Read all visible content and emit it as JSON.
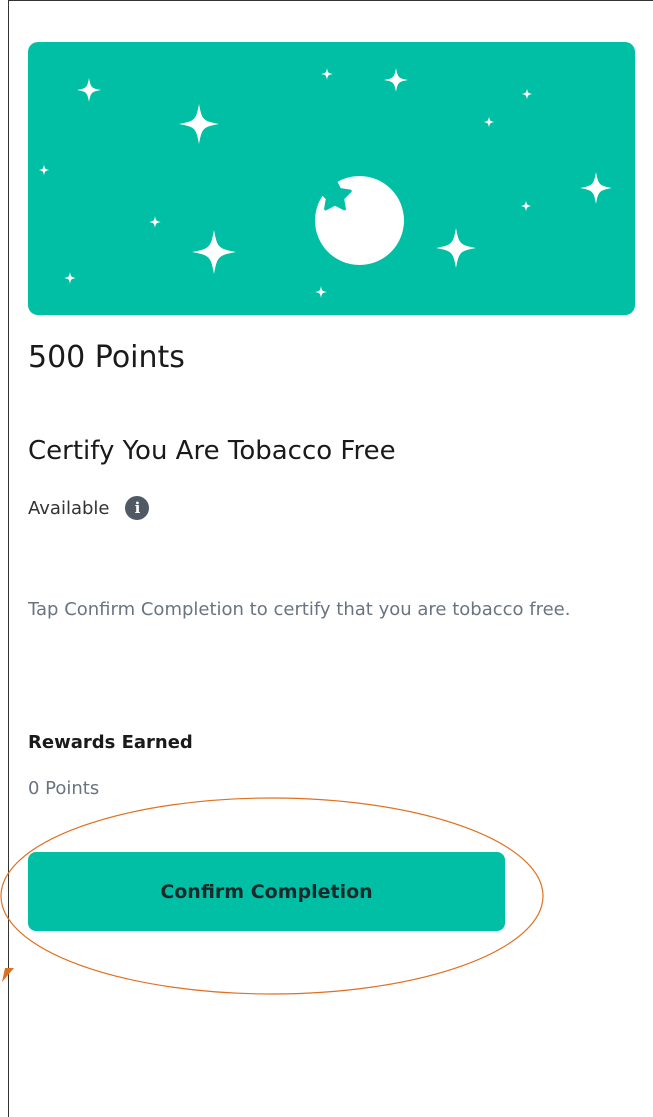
{
  "reward": {
    "points_title": "500 Points",
    "task_title": "Certify You Are Tobacco Free",
    "status": "Available",
    "info_icon": "info-icon",
    "description": "Tap Confirm Completion to certify that you are tobacco free.",
    "rewards_label": "Rewards Earned",
    "rewards_value": "0 Points",
    "confirm_label": "Confirm Completion"
  },
  "colors": {
    "accent": "#00bfa5",
    "annotation": "#e07020",
    "info_icon_bg": "#505a64"
  }
}
